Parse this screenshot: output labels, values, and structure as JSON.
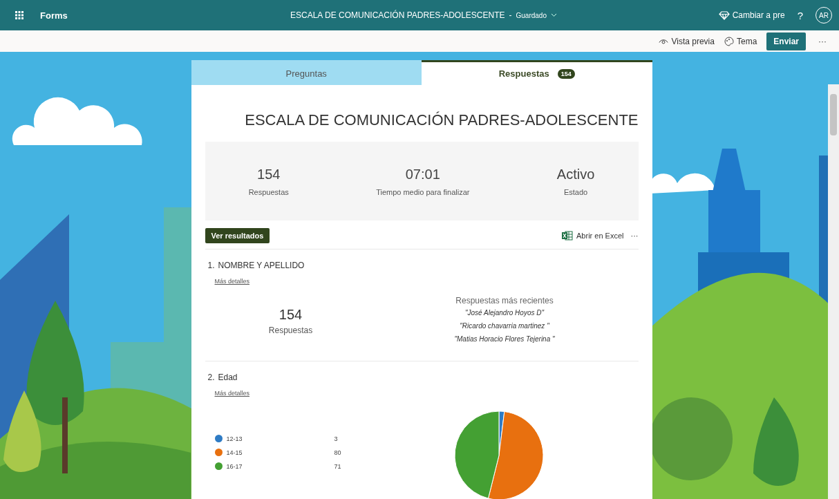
{
  "app_bar": {
    "app_name": "Forms",
    "form_title": "ESCALA DE COMUNICACIÓN PADRES-ADOLESCENTE",
    "separator": "-",
    "save_state": "Guardado",
    "upgrade": "Cambiar a pre",
    "help": "?",
    "avatar": "AR"
  },
  "toolbar": {
    "preview": "Vista previa",
    "theme": "Tema",
    "send": "Enviar",
    "more": "···"
  },
  "tabs": [
    {
      "label": "Preguntas",
      "selected": false
    },
    {
      "label": "Respuestas",
      "selected": true,
      "badge": "154"
    }
  ],
  "form": {
    "title": "ESCALA DE COMUNICACIÓN PADRES-ADOLESCENTE",
    "stats": [
      {
        "value": "154",
        "label": "Respuestas"
      },
      {
        "value": "07:01",
        "label": "Tiempo medio para finalizar"
      },
      {
        "value": "Activo",
        "label": "Estado"
      }
    ],
    "view_results": "Ver resultados",
    "open_excel": "Abrir en Excel",
    "more": "···"
  },
  "questions": [
    {
      "kind": "text",
      "number": "1.",
      "title": "NOMBRE  Y APELLIDO",
      "details": "Más detalles",
      "count": "154",
      "count_label": "Respuestas",
      "recent_title": "Respuestas más recientes",
      "recent": [
        "\"José Alejandro Hoyos D\"",
        "\"Ricardo chavarria martinez \"",
        "\"Matias Horacio Flores Tejerina \""
      ]
    },
    {
      "kind": "choice",
      "number": "2.",
      "title": "Edad",
      "details": "Más detalles",
      "options": [
        {
          "color": "#2e7bc4"
        },
        {
          "color": "#e8700f"
        },
        {
          "color": "#44a033"
        }
      ],
      "chart_data": {
        "type": "pie",
        "categories": [
          "12-13",
          "14-15",
          "16-17"
        ],
        "values": [
          3,
          80,
          71
        ],
        "value_labels": [
          "3",
          "80",
          "71"
        ],
        "legend": "left"
      }
    }
  ]
}
